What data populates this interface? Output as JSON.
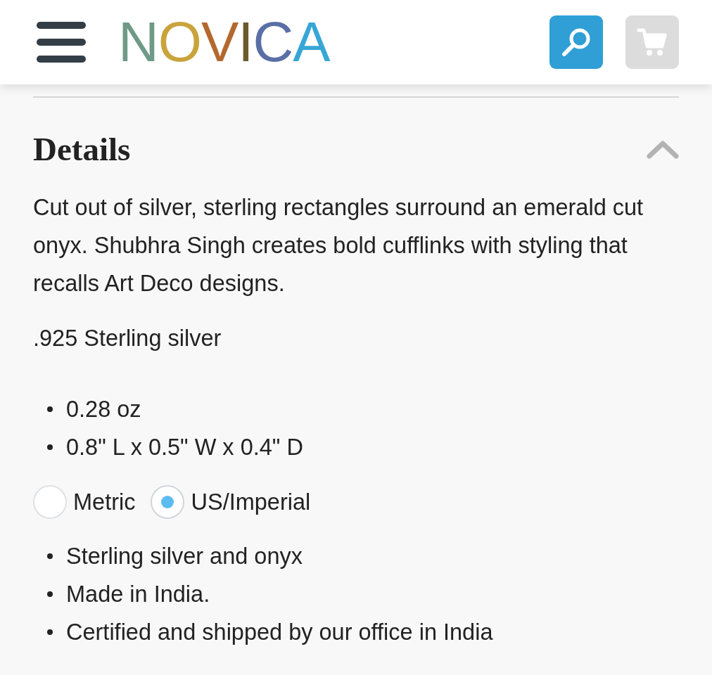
{
  "header": {
    "logo": "NOVICA"
  },
  "details": {
    "title": "Details",
    "expanded": true,
    "description": "Cut out of silver, sterling rectangles surround an emerald cut onyx. Shubhra Singh creates bold cufflinks with styling that recalls Art Deco designs.",
    "material": ".925 Sterling silver",
    "measurements": [
      "0.28 oz",
      "0.8\" L x 0.5\" W x 0.4\" D"
    ],
    "units": [
      {
        "label": "Metric",
        "selected": false
      },
      {
        "label": "US/Imperial",
        "selected": true
      }
    ],
    "features": [
      "Sterling silver and onyx",
      "Made in India.",
      "Certified and shipped by our office in India"
    ]
  }
}
